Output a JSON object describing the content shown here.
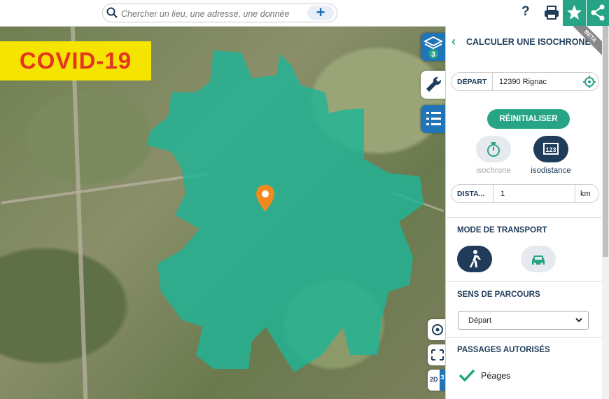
{
  "header": {
    "search_placeholder": "Chercher un lieu, une adresse, une donnée",
    "help_label": "?"
  },
  "banner": {
    "text": "COVID-19"
  },
  "tools": {
    "layers_count": "3"
  },
  "panel": {
    "title": "CALCULER UNE ISOCHRONE",
    "beta_label": "BETA",
    "depart_label": "DÉPART",
    "depart_value": "12390 Rignac",
    "reset_label": "RÉINITIALISER",
    "mode_isochrone": "isochrone",
    "mode_isodistance": "isodistance",
    "distance_label": "DISTA...",
    "distance_value": "1",
    "distance_unit": "km",
    "transport_title": "MODE DE TRANSPORT",
    "direction_title": "SENS DE PARCOURS",
    "direction_value": "Départ",
    "passages_title": "PASSAGES AUTORISÉS",
    "peages_label": "Péages"
  },
  "map_controls": {
    "view_2d": "2D",
    "view_3d_partial": "3"
  },
  "colors": {
    "accent": "#27a486",
    "dark": "#1f3c5a",
    "isochrone_fill": "#1fb596",
    "marker": "#f08a1c",
    "banner_bg": "#f5e400",
    "banner_text": "#e43524"
  }
}
